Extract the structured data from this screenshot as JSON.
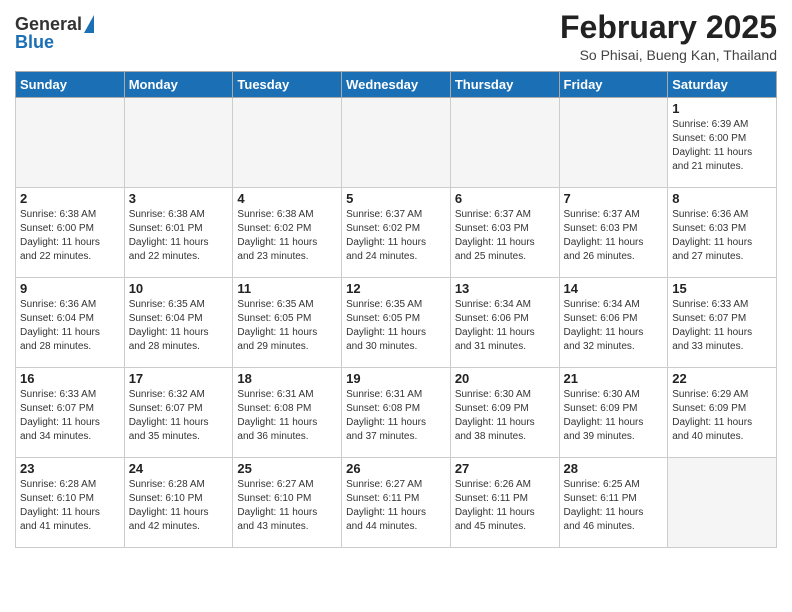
{
  "logo": {
    "general": "General",
    "blue": "Blue"
  },
  "title": "February 2025",
  "location": "So Phisai, Bueng Kan, Thailand",
  "weekdays": [
    "Sunday",
    "Monday",
    "Tuesday",
    "Wednesday",
    "Thursday",
    "Friday",
    "Saturday"
  ],
  "weeks": [
    [
      {
        "day": "",
        "info": ""
      },
      {
        "day": "",
        "info": ""
      },
      {
        "day": "",
        "info": ""
      },
      {
        "day": "",
        "info": ""
      },
      {
        "day": "",
        "info": ""
      },
      {
        "day": "",
        "info": ""
      },
      {
        "day": "1",
        "info": "Sunrise: 6:39 AM\nSunset: 6:00 PM\nDaylight: 11 hours\nand 21 minutes."
      }
    ],
    [
      {
        "day": "2",
        "info": "Sunrise: 6:38 AM\nSunset: 6:00 PM\nDaylight: 11 hours\nand 22 minutes."
      },
      {
        "day": "3",
        "info": "Sunrise: 6:38 AM\nSunset: 6:01 PM\nDaylight: 11 hours\nand 22 minutes."
      },
      {
        "day": "4",
        "info": "Sunrise: 6:38 AM\nSunset: 6:02 PM\nDaylight: 11 hours\nand 23 minutes."
      },
      {
        "day": "5",
        "info": "Sunrise: 6:37 AM\nSunset: 6:02 PM\nDaylight: 11 hours\nand 24 minutes."
      },
      {
        "day": "6",
        "info": "Sunrise: 6:37 AM\nSunset: 6:03 PM\nDaylight: 11 hours\nand 25 minutes."
      },
      {
        "day": "7",
        "info": "Sunrise: 6:37 AM\nSunset: 6:03 PM\nDaylight: 11 hours\nand 26 minutes."
      },
      {
        "day": "8",
        "info": "Sunrise: 6:36 AM\nSunset: 6:03 PM\nDaylight: 11 hours\nand 27 minutes."
      }
    ],
    [
      {
        "day": "9",
        "info": "Sunrise: 6:36 AM\nSunset: 6:04 PM\nDaylight: 11 hours\nand 28 minutes."
      },
      {
        "day": "10",
        "info": "Sunrise: 6:35 AM\nSunset: 6:04 PM\nDaylight: 11 hours\nand 28 minutes."
      },
      {
        "day": "11",
        "info": "Sunrise: 6:35 AM\nSunset: 6:05 PM\nDaylight: 11 hours\nand 29 minutes."
      },
      {
        "day": "12",
        "info": "Sunrise: 6:35 AM\nSunset: 6:05 PM\nDaylight: 11 hours\nand 30 minutes."
      },
      {
        "day": "13",
        "info": "Sunrise: 6:34 AM\nSunset: 6:06 PM\nDaylight: 11 hours\nand 31 minutes."
      },
      {
        "day": "14",
        "info": "Sunrise: 6:34 AM\nSunset: 6:06 PM\nDaylight: 11 hours\nand 32 minutes."
      },
      {
        "day": "15",
        "info": "Sunrise: 6:33 AM\nSunset: 6:07 PM\nDaylight: 11 hours\nand 33 minutes."
      }
    ],
    [
      {
        "day": "16",
        "info": "Sunrise: 6:33 AM\nSunset: 6:07 PM\nDaylight: 11 hours\nand 34 minutes."
      },
      {
        "day": "17",
        "info": "Sunrise: 6:32 AM\nSunset: 6:07 PM\nDaylight: 11 hours\nand 35 minutes."
      },
      {
        "day": "18",
        "info": "Sunrise: 6:31 AM\nSunset: 6:08 PM\nDaylight: 11 hours\nand 36 minutes."
      },
      {
        "day": "19",
        "info": "Sunrise: 6:31 AM\nSunset: 6:08 PM\nDaylight: 11 hours\nand 37 minutes."
      },
      {
        "day": "20",
        "info": "Sunrise: 6:30 AM\nSunset: 6:09 PM\nDaylight: 11 hours\nand 38 minutes."
      },
      {
        "day": "21",
        "info": "Sunrise: 6:30 AM\nSunset: 6:09 PM\nDaylight: 11 hours\nand 39 minutes."
      },
      {
        "day": "22",
        "info": "Sunrise: 6:29 AM\nSunset: 6:09 PM\nDaylight: 11 hours\nand 40 minutes."
      }
    ],
    [
      {
        "day": "23",
        "info": "Sunrise: 6:28 AM\nSunset: 6:10 PM\nDaylight: 11 hours\nand 41 minutes."
      },
      {
        "day": "24",
        "info": "Sunrise: 6:28 AM\nSunset: 6:10 PM\nDaylight: 11 hours\nand 42 minutes."
      },
      {
        "day": "25",
        "info": "Sunrise: 6:27 AM\nSunset: 6:10 PM\nDaylight: 11 hours\nand 43 minutes."
      },
      {
        "day": "26",
        "info": "Sunrise: 6:27 AM\nSunset: 6:11 PM\nDaylight: 11 hours\nand 44 minutes."
      },
      {
        "day": "27",
        "info": "Sunrise: 6:26 AM\nSunset: 6:11 PM\nDaylight: 11 hours\nand 45 minutes."
      },
      {
        "day": "28",
        "info": "Sunrise: 6:25 AM\nSunset: 6:11 PM\nDaylight: 11 hours\nand 46 minutes."
      },
      {
        "day": "",
        "info": ""
      }
    ]
  ]
}
